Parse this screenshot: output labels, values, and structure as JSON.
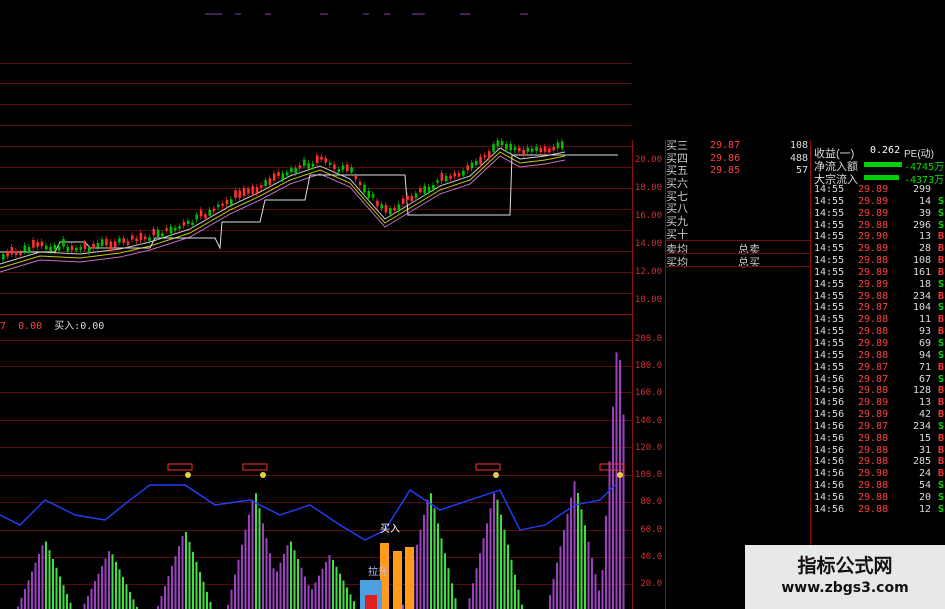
{
  "indicator_bar": {
    "left_value": "7",
    "val1": "0.00",
    "buy_label": "买入:",
    "buy_value": "0.00"
  },
  "price_axis": [
    "20.00",
    "18.00",
    "16.00",
    "14.00",
    "12.00",
    "10.00"
  ],
  "indicator_axis": [
    "200.0",
    "180.0",
    "160.0",
    "140.0",
    "120.0",
    "100.0",
    "80.0",
    "60.0",
    "40.0",
    "20.0"
  ],
  "order_book": [
    {
      "label": "买三",
      "price": "29.87",
      "vol": "108"
    },
    {
      "label": "买四",
      "price": "29.86",
      "vol": "488"
    },
    {
      "label": "买五",
      "price": "29.85",
      "vol": "57"
    },
    {
      "label": "买六",
      "price": "",
      "vol": ""
    },
    {
      "label": "买七",
      "price": "",
      "vol": ""
    },
    {
      "label": "买八",
      "price": "",
      "vol": ""
    },
    {
      "label": "买九",
      "price": "",
      "vol": ""
    },
    {
      "label": "买十",
      "price": "",
      "vol": ""
    }
  ],
  "order_summary": [
    {
      "label": "卖均",
      "right": "总卖"
    },
    {
      "label": "买均",
      "right": "总买"
    }
  ],
  "stats": [
    {
      "label": "收益(一)",
      "value": "0.262",
      "extra": "PE(动)"
    },
    {
      "label": "净流入额",
      "value": "-4745万"
    },
    {
      "label": "大宗流入",
      "value": "-4373万"
    }
  ],
  "ticks": [
    {
      "t": "14:55",
      "p": "29.89",
      "v": "299",
      "s": ""
    },
    {
      "t": "14:55",
      "p": "29.89",
      "v": "14",
      "s": "S"
    },
    {
      "t": "14:55",
      "p": "29.89",
      "v": "39",
      "s": "S"
    },
    {
      "t": "14:55",
      "p": "29.88",
      "v": "296",
      "s": "S"
    },
    {
      "t": "14:55",
      "p": "29.90",
      "v": "13",
      "s": "B"
    },
    {
      "t": "14:55",
      "p": "29.89",
      "v": "28",
      "s": "B"
    },
    {
      "t": "14:55",
      "p": "29.88",
      "v": "108",
      "s": "B"
    },
    {
      "t": "14:55",
      "p": "29.89",
      "v": "161",
      "s": "B"
    },
    {
      "t": "14:55",
      "p": "29.89",
      "v": "18",
      "s": "S"
    },
    {
      "t": "14:55",
      "p": "29.88",
      "v": "234",
      "s": "B"
    },
    {
      "t": "14:55",
      "p": "29.87",
      "v": "104",
      "s": "S"
    },
    {
      "t": "14:55",
      "p": "29.88",
      "v": "11",
      "s": "B"
    },
    {
      "t": "14:55",
      "p": "29.88",
      "v": "93",
      "s": "B"
    },
    {
      "t": "14:55",
      "p": "29.89",
      "v": "69",
      "s": "S"
    },
    {
      "t": "14:55",
      "p": "29.88",
      "v": "94",
      "s": "S"
    },
    {
      "t": "14:55",
      "p": "29.87",
      "v": "71",
      "s": "B"
    },
    {
      "t": "14:56",
      "p": "29.87",
      "v": "67",
      "s": "S"
    },
    {
      "t": "14:56",
      "p": "29.88",
      "v": "128",
      "s": "B"
    },
    {
      "t": "14:56",
      "p": "29.89",
      "v": "13",
      "s": "B"
    },
    {
      "t": "14:56",
      "p": "29.89",
      "v": "42",
      "s": "B"
    },
    {
      "t": "14:56",
      "p": "29.87",
      "v": "234",
      "s": "S"
    },
    {
      "t": "14:56",
      "p": "29.88",
      "v": "15",
      "s": "B"
    },
    {
      "t": "14:56",
      "p": "29.88",
      "v": "31",
      "s": "B"
    },
    {
      "t": "14:56",
      "p": "29.88",
      "v": "285",
      "s": "B"
    },
    {
      "t": "14:56",
      "p": "29.90",
      "v": "24",
      "s": "B"
    },
    {
      "t": "14:56",
      "p": "29.88",
      "v": "54",
      "s": "S"
    },
    {
      "t": "14:56",
      "p": "29.88",
      "v": "20",
      "s": "S"
    },
    {
      "t": "14:56",
      "p": "29.88",
      "v": "12",
      "s": "S"
    }
  ],
  "chart_labels": {
    "buy_tag": "买入",
    "pump_tag": "拉升"
  },
  "watermark": {
    "line1": "指标公式网",
    "line2": "www.zbgs3.com"
  },
  "colors": {
    "up": "#ff3030",
    "down": "#00e000",
    "grid": "#5a0a0a",
    "bg": "#000000"
  }
}
